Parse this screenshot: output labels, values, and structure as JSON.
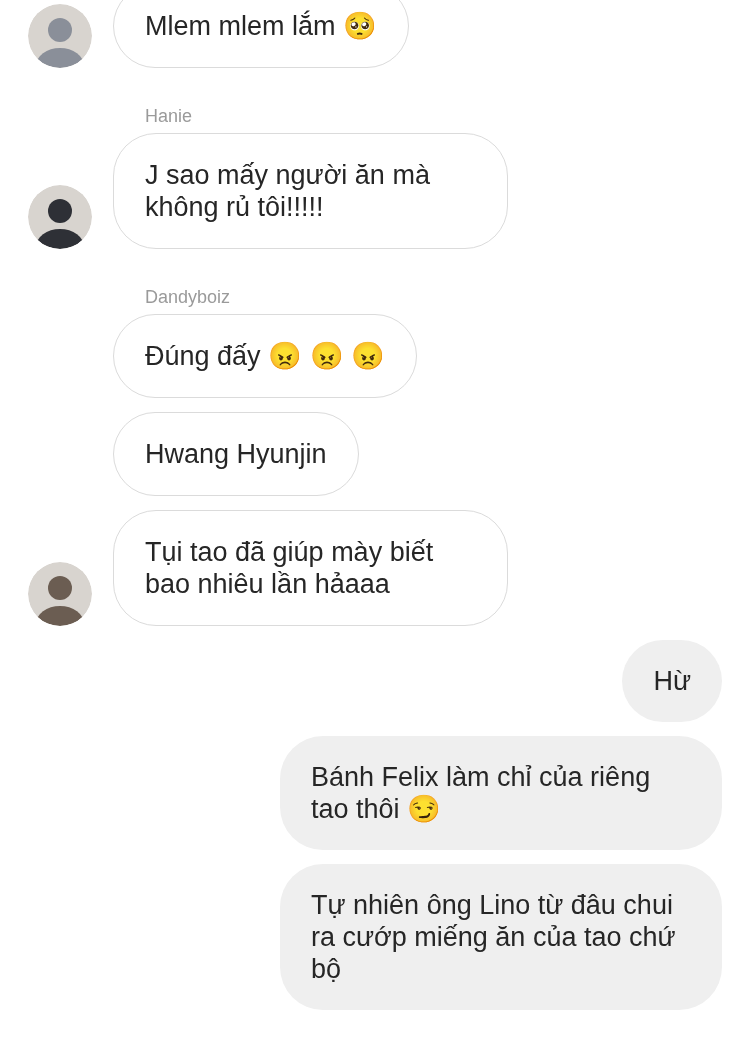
{
  "messages": [
    {
      "kind": "received",
      "text": "Mlem mlem lắm 🥺",
      "avatar": true
    },
    {
      "kind": "received",
      "sender": "Hanie",
      "text": "J sao mấy người ăn mà không rủ tôi!!!!!",
      "avatar": true
    },
    {
      "kind": "received",
      "sender": "Dandyboiz",
      "text": "Đúng đấy 😠 😠 😠",
      "avatar": false
    },
    {
      "kind": "received",
      "text": "Hwang Hyunjin",
      "avatar": false
    },
    {
      "kind": "received",
      "text": "Tụi tao đã giúp mày biết bao nhiêu lần hảaaa",
      "avatar": true
    },
    {
      "kind": "sent",
      "text": "Hừ"
    },
    {
      "kind": "sent",
      "text": "Bánh Felix làm chỉ của riêng tao thôi 😏"
    },
    {
      "kind": "sent",
      "text": "Tự nhiên ông Lino từ đâu chui ra cướp miếng ăn của tao chứ bộ"
    }
  ]
}
